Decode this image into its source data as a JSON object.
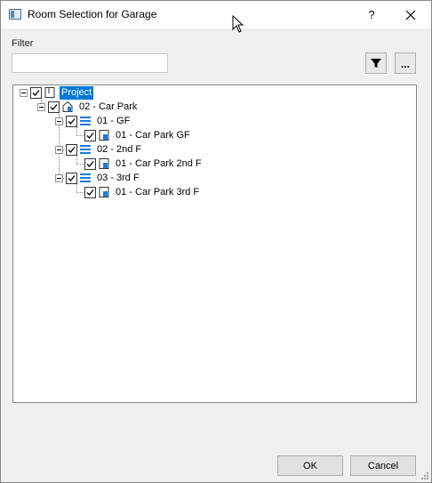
{
  "window": {
    "title": "Room Selection for Garage",
    "help_label": "?"
  },
  "filter": {
    "label": "Filter",
    "value": "",
    "placeholder": ""
  },
  "toolbar": {
    "filter_icon": "funnel-icon",
    "more_label": "..."
  },
  "tree": {
    "root": {
      "label": "Project",
      "checked": true,
      "icon": "project-icon"
    },
    "building": {
      "label": "02 - Car Park",
      "checked": true,
      "icon": "building-icon"
    },
    "levels": [
      {
        "label": "01 - GF",
        "checked": true,
        "icon": "level-icon",
        "room": {
          "label": "01 - Car Park GF",
          "checked": true,
          "icon": "room-icon"
        }
      },
      {
        "label": "02 - 2nd F",
        "checked": true,
        "icon": "level-icon",
        "room": {
          "label": "01 - Car Park 2nd F",
          "checked": true,
          "icon": "room-icon"
        }
      },
      {
        "label": "03 - 3rd F",
        "checked": true,
        "icon": "level-icon",
        "room": {
          "label": "01 - Car Park 3rd F",
          "checked": true,
          "icon": "room-icon"
        }
      }
    ]
  },
  "buttons": {
    "ok": "OK",
    "cancel": "Cancel"
  }
}
